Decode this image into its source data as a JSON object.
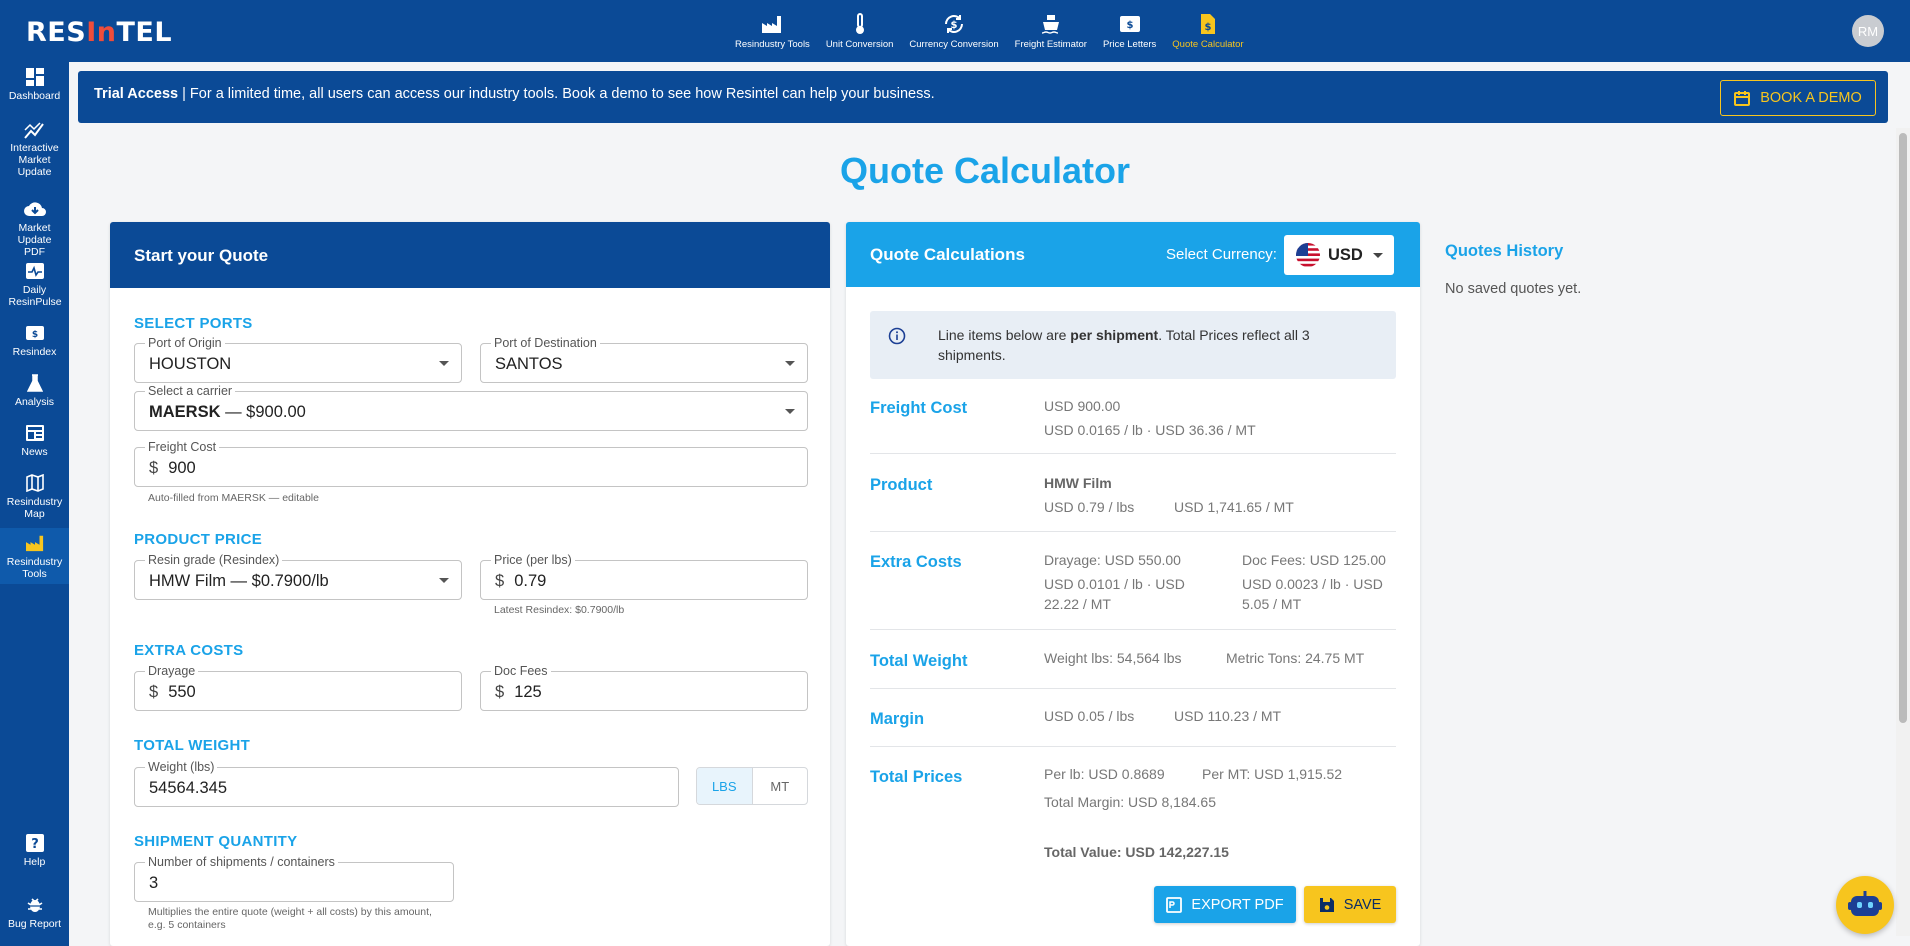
{
  "app": {
    "logo_left": "RES",
    "logo_accent": "In",
    "logo_right": "TEL",
    "avatar_initials": "RM"
  },
  "topnav": [
    {
      "label": "Resindustry Tools",
      "icon": "factory-icon"
    },
    {
      "label": "Unit Conversion",
      "icon": "thermometer-icon"
    },
    {
      "label": "Currency Conversion",
      "icon": "currency-exchange-icon"
    },
    {
      "label": "Freight Estimator",
      "icon": "ship-icon"
    },
    {
      "label": "Price Letters",
      "icon": "price-tag-icon"
    },
    {
      "label": "Quote Calculator",
      "icon": "quote-document-icon",
      "active": true
    }
  ],
  "sidebar": [
    {
      "label": "Dashboard",
      "icon": "dashboard-icon"
    },
    {
      "label": "Interactive Market Update",
      "icon": "chart-line-icon"
    },
    {
      "label": "Market Update PDF",
      "icon": "cloud-download-icon"
    },
    {
      "label": "Daily ResinPulse",
      "icon": "pulse-icon"
    },
    {
      "label": "Resindex",
      "icon": "price-tag-icon"
    },
    {
      "label": "Analysis",
      "icon": "flask-icon"
    },
    {
      "label": "News",
      "icon": "news-icon"
    },
    {
      "label": "Resindustry Map",
      "icon": "map-icon"
    },
    {
      "label": "Resindustry Tools",
      "icon": "factory-icon",
      "active": true
    },
    {
      "label": "Help",
      "icon": "help-icon"
    },
    {
      "label": "Bug Report",
      "icon": "bug-icon"
    }
  ],
  "banner": {
    "bold": "Trial Access",
    "text": " | For a limited time, all users can access our industry tools. Book a demo to see how Resintel can help your business.",
    "button": "BOOK A DEMO"
  },
  "page_title": "Quote Calculator",
  "start_quote": {
    "title": "Start your Quote",
    "ports": {
      "section": "SELECT PORTS",
      "origin_label": "Port of Origin",
      "origin_value": "HOUSTON",
      "destination_label": "Port of Destination",
      "destination_value": "SANTOS",
      "carrier_label": "Select a carrier",
      "carrier_name": "MAERSK",
      "carrier_price": " — $900.00",
      "freight_label": "Freight Cost",
      "freight_currency": "$",
      "freight_value": "900",
      "freight_helper": "Auto-filled from MAERSK — editable"
    },
    "product": {
      "section": "PRODUCT PRICE",
      "grade_label": "Resin grade (Resindex)",
      "grade_value": "HMW Film — $0.7900/lb",
      "price_label": "Price (per lbs)",
      "price_currency": "$",
      "price_value": "0.79",
      "price_helper": "Latest Resindex: $0.7900/lb"
    },
    "extra": {
      "section": "EXTRA COSTS",
      "drayage_label": "Drayage",
      "drayage_currency": "$",
      "drayage_value": "550",
      "doc_label": "Doc Fees",
      "doc_currency": "$",
      "doc_value": "125"
    },
    "weight": {
      "section": "TOTAL WEIGHT",
      "label": "Weight (lbs)",
      "value": "54564.345",
      "unit_lbs": "LBS",
      "unit_mt": "MT",
      "selected_unit": "LBS"
    },
    "shipment": {
      "section": "SHIPMENT QUANTITY",
      "label": "Number of shipments / containers",
      "value": "3",
      "helper": "Multiplies the entire quote (weight + all costs) by this amount, e.g. 5 containers"
    }
  },
  "calc": {
    "title": "Quote Calculations",
    "select_currency_label": "Select Currency:",
    "currency": "USD",
    "info_pre": "Line items below are ",
    "info_bold": "per shipment",
    "info_post": ". Total Prices reflect all 3 shipments.",
    "freight": {
      "label": "Freight Cost",
      "line1": "USD 900.00",
      "line2": "USD 0.0165 / lb · USD 36.36 / MT"
    },
    "product": {
      "label": "Product",
      "name": "HMW Film",
      "per_lbs": "USD 0.79 / lbs",
      "per_mt": "USD 1,741.65 / MT"
    },
    "extra": {
      "label": "Extra Costs",
      "drayage": "Drayage: USD 550.00",
      "drayage_detail": "USD 0.0101 / lb · USD 22.22 / MT",
      "doc": "Doc Fees: USD 125.00",
      "doc_detail": "USD 0.0023 / lb · USD 5.05 / MT"
    },
    "weight": {
      "label": "Total Weight",
      "lbs": "Weight lbs: 54,564 lbs",
      "mt": "Metric Tons: 24.75 MT"
    },
    "margin": {
      "label": "Margin",
      "per_lbs": "USD 0.05 / lbs",
      "per_mt": "USD 110.23 / MT"
    },
    "totals": {
      "label": "Total Prices",
      "per_lb": "Per lb: USD 0.8689",
      "per_mt": "Per MT: USD 1,915.52",
      "margin": "Total Margin: USD 8,184.65",
      "value": "Total Value: USD 142,227.15"
    },
    "export_button": "EXPORT PDF",
    "save_button": "SAVE"
  },
  "history": {
    "title": "Quotes History",
    "empty": "No saved quotes yet."
  },
  "colors": {
    "navy": "#0b4a96",
    "accent_blue": "#1aa3e8",
    "yellow": "#f7c51e"
  }
}
